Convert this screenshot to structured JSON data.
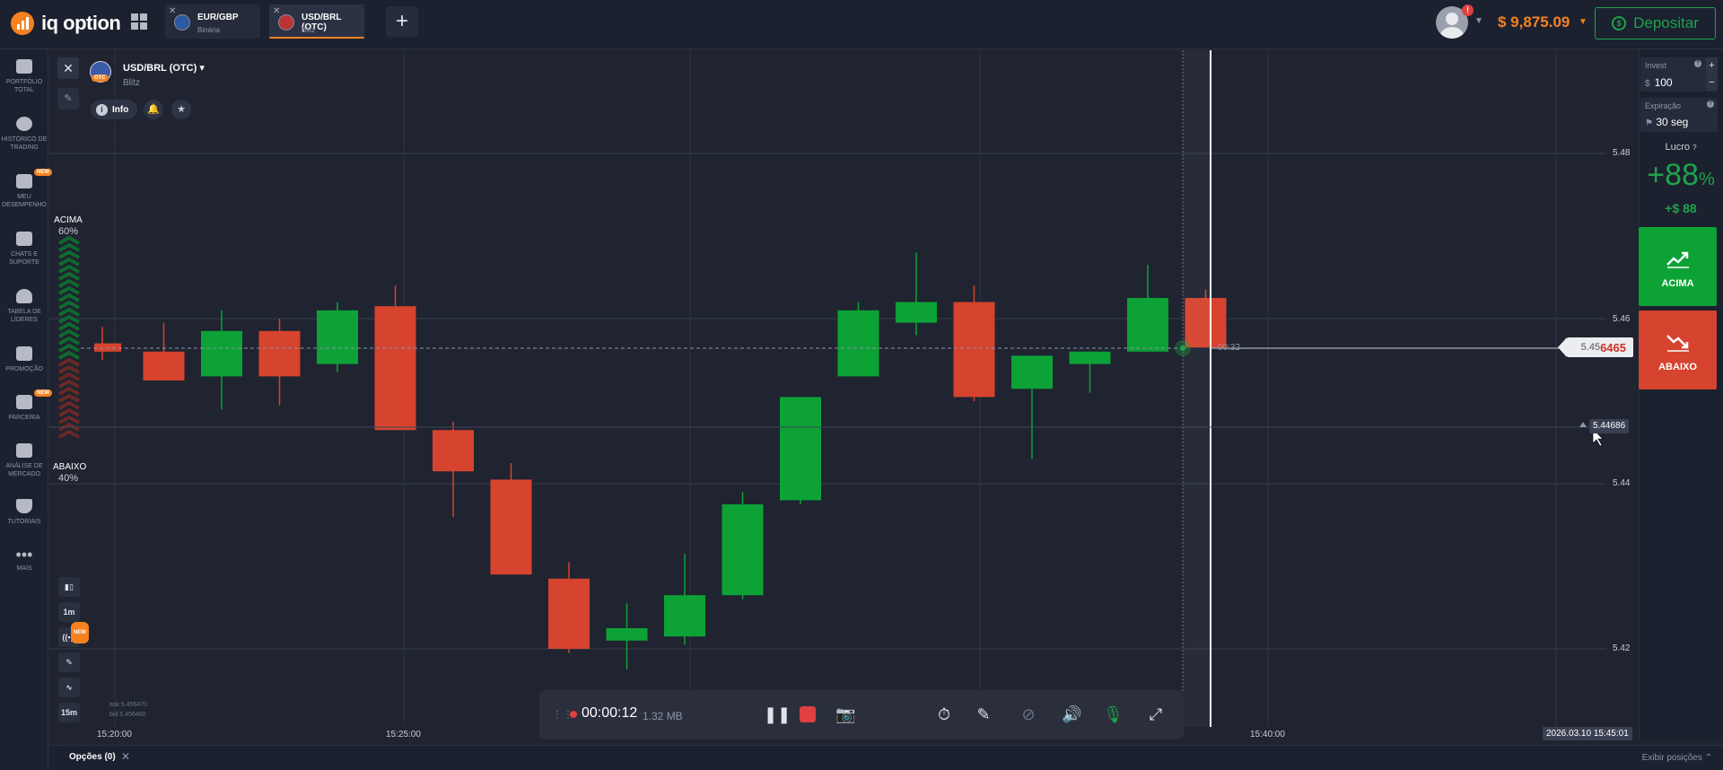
{
  "header": {
    "logo_text": "iq option",
    "tabs": [
      {
        "name": "EUR/GBP",
        "sub": "Binária"
      },
      {
        "name": "USD/BRL (OTC)",
        "sub": "Blitz"
      }
    ],
    "add_tab": "+",
    "alert_count": "!",
    "balance": "$ 9,875.09",
    "deposit_label": "Depositar"
  },
  "sidebar": {
    "items": [
      {
        "label": "PORTFÓLIO TOTAL",
        "icon": "briefcase-icon"
      },
      {
        "label": "HISTÓRICO DE TRADING",
        "icon": "clock-icon"
      },
      {
        "label": "MEU DESEMPENHO",
        "icon": "performance-icon",
        "badge": "NEW"
      },
      {
        "label": "CHATS E SUPORTE",
        "icon": "chat-icon"
      },
      {
        "label": "TABELA DE LÍDERES",
        "icon": "leader-icon"
      },
      {
        "label": "PROMOÇÃO",
        "icon": "promo-icon"
      },
      {
        "label": "PARCERIA",
        "icon": "partner-icon",
        "badge": "NEW"
      },
      {
        "label": "ANÁLISE DE MERCADO",
        "icon": "analysis-icon"
      },
      {
        "label": "TUTORIAIS",
        "icon": "tutorial-icon"
      },
      {
        "label": "MAIS",
        "icon": "more-icon"
      }
    ]
  },
  "asset": {
    "name": "USD/BRL (OTC)",
    "sub": "Blitz",
    "otc_badge": "OTC",
    "info_label": "Info"
  },
  "sentiment": {
    "up_label": "ACIMA",
    "up_pct": "60%",
    "down_label": "ABAIXO",
    "down_pct": "40%"
  },
  "left_tools": [
    "1m",
    "15m"
  ],
  "chart": {
    "price_labels": [
      "5.48",
      "5.46",
      "5.44",
      "5.42"
    ],
    "current_price_prefix": "5.45",
    "current_price_suffix": "6465",
    "alert_price": "5.44686",
    "countdown": "00:32",
    "time_labels": [
      "15:20:00",
      "15:25:00",
      "15:40:00"
    ],
    "date_label": "2026.03.10 15:45:01",
    "ask": "ask 5.456470",
    "bid": "bid 5.456460"
  },
  "chart_data": {
    "type": "candlestick",
    "symbol": "USD/BRL (OTC)",
    "y_ticks": [
      5.42,
      5.44,
      5.46,
      5.48
    ],
    "up_color": "#0ca236",
    "down_color": "#d6432e",
    "candles": [
      {
        "o": 5.457,
        "h": 5.459,
        "l": 5.455,
        "c": 5.456
      },
      {
        "o": 5.456,
        "h": 5.4595,
        "l": 5.4525,
        "c": 5.4525
      },
      {
        "o": 5.453,
        "h": 5.461,
        "l": 5.449,
        "c": 5.4585
      },
      {
        "o": 5.4585,
        "h": 5.46,
        "l": 5.4495,
        "c": 5.453
      },
      {
        "o": 5.4545,
        "h": 5.462,
        "l": 5.4535,
        "c": 5.461
      },
      {
        "o": 5.4615,
        "h": 5.464,
        "l": 5.448,
        "c": 5.4465
      },
      {
        "o": 5.4465,
        "h": 5.4475,
        "l": 5.436,
        "c": 5.4415
      },
      {
        "o": 5.4405,
        "h": 5.4425,
        "l": 5.429,
        "c": 5.429
      },
      {
        "o": 5.4285,
        "h": 5.4305,
        "l": 5.4195,
        "c": 5.42
      },
      {
        "o": 5.421,
        "h": 5.4255,
        "l": 5.4175,
        "c": 5.4225
      },
      {
        "o": 5.4215,
        "h": 5.4315,
        "l": 5.4205,
        "c": 5.4265
      },
      {
        "o": 5.4265,
        "h": 5.439,
        "l": 5.426,
        "c": 5.4375
      },
      {
        "o": 5.438,
        "h": 5.4495,
        "l": 5.4375,
        "c": 5.4505
      },
      {
        "o": 5.453,
        "h": 5.462,
        "l": 5.453,
        "c": 5.461
      },
      {
        "o": 5.4595,
        "h": 5.468,
        "l": 5.458,
        "c": 5.462
      },
      {
        "o": 5.462,
        "h": 5.464,
        "l": 5.45,
        "c": 5.4505
      },
      {
        "o": 5.4515,
        "h": 5.455,
        "l": 5.443,
        "c": 5.4555
      },
      {
        "o": 5.4545,
        "h": 5.456,
        "l": 5.451,
        "c": 5.456
      },
      {
        "o": 5.456,
        "h": 5.4665,
        "l": 5.456,
        "c": 5.4625
      },
      {
        "o": 5.4625,
        "h": 5.4635,
        "l": 5.4565,
        "c": 5.4565
      }
    ]
  },
  "right_panel": {
    "invest_label": "Invest",
    "invest_currency": "$",
    "invest_value": "100",
    "expiry_label": "Expiração",
    "expiry_value": "30 seg",
    "profit_label": "Lucro",
    "profit_pct": "+88",
    "profit_pct_sign": "%",
    "profit_amount": "+$ 88",
    "up_label": "ACIMA",
    "down_label": "ABAIXO"
  },
  "recorder": {
    "time": "00:00:12",
    "size": "1.32 MB"
  },
  "bottom": {
    "options_tab": "Opções (0)",
    "show_positions": "Exibir posições"
  }
}
